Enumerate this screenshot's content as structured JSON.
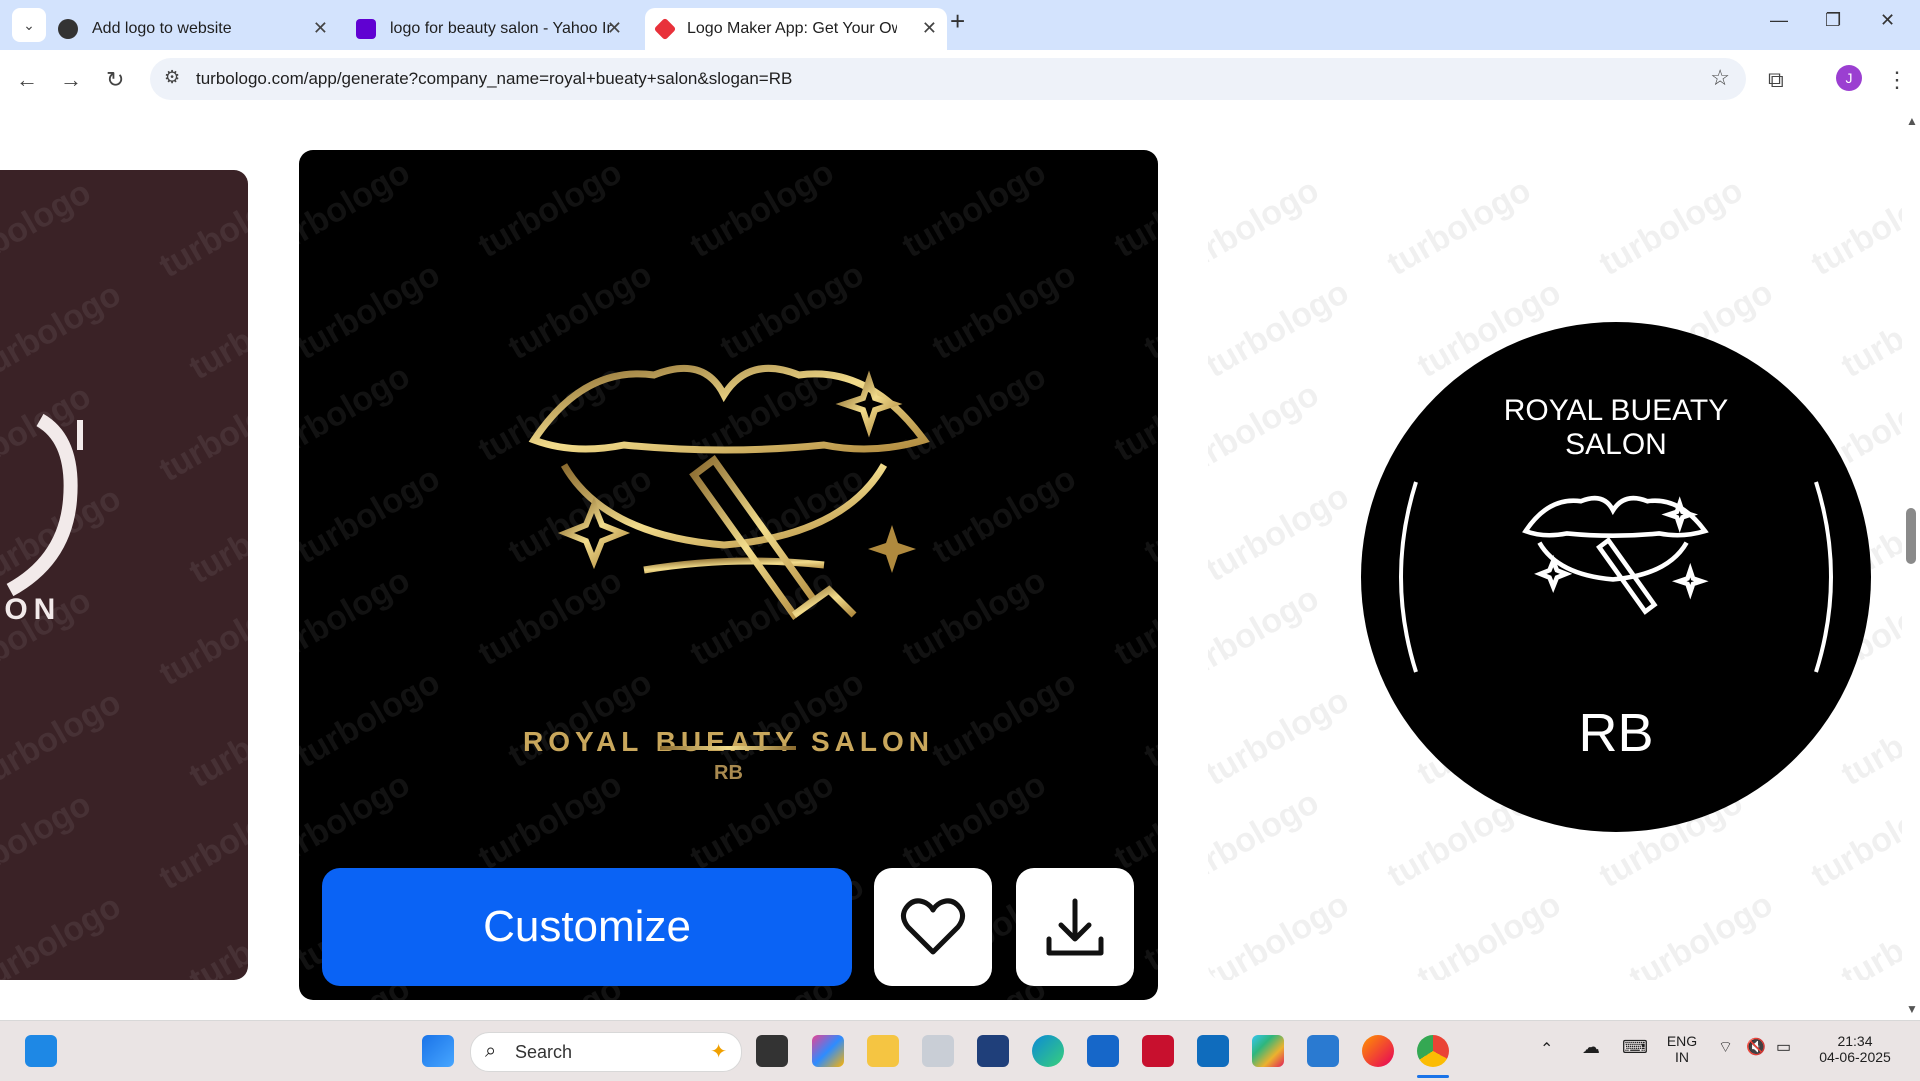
{
  "browser": {
    "tabs": [
      {
        "title": "Add logo to website",
        "active": false
      },
      {
        "title": "logo for beauty salon - Yahoo Ir",
        "active": false
      },
      {
        "title": "Logo Maker App: Get Your Own",
        "active": true
      }
    ],
    "new_tab": "+",
    "url": "turbologo.com/app/generate?company_name=royal+bueaty+salon&slogan=RB",
    "profile_initial": "J"
  },
  "page": {
    "watermark": "turbologo",
    "left_card": {
      "partial_text": "LON",
      "bg": "#3a2226"
    },
    "main_card": {
      "company_name": "ROYAL BUEATY SALON",
      "slogan": "RB",
      "customize_label": "Customize",
      "accent": "#0a63f5",
      "gold": "#c9a75c"
    },
    "right_card": {
      "company_name_line1": "ROYAL BUEATY",
      "company_name_line2": "SALON",
      "slogan": "RB"
    }
  },
  "taskbar": {
    "search_placeholder": "Search",
    "lang_line1": "ENG",
    "lang_line2": "IN",
    "time": "21:34",
    "date": "04-06-2025"
  }
}
